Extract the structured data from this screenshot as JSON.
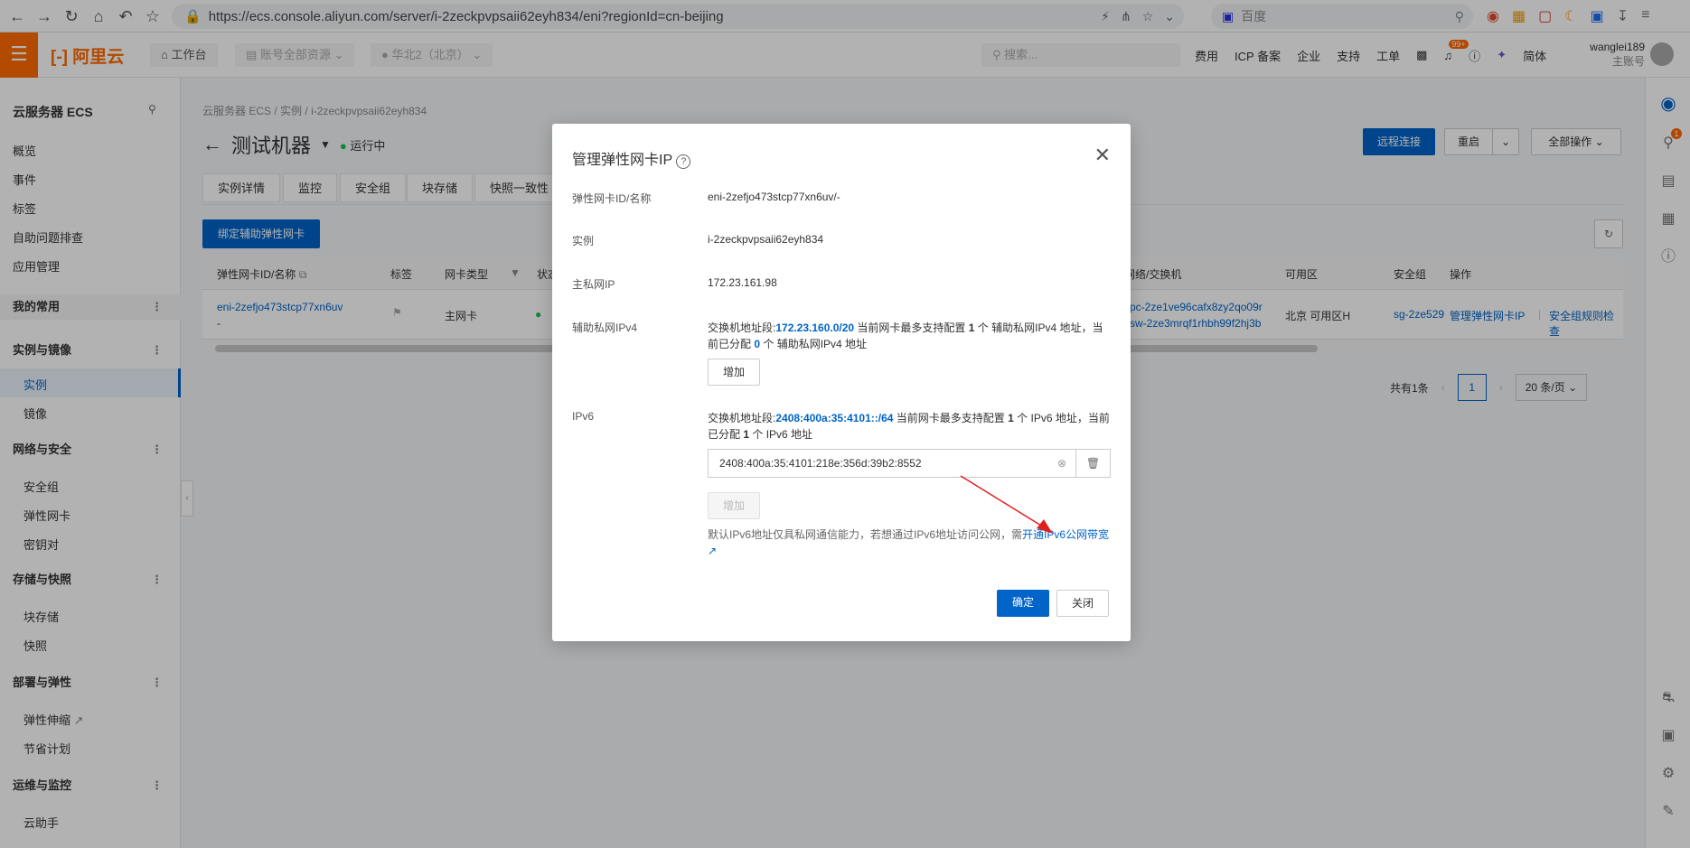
{
  "browser": {
    "url": "https://ecs.console.aliyun.com/server/i-2zeckpvpsaii62eyh834/eni?regionId=cn-beijing",
    "search_placeholder": "百度"
  },
  "topbar": {
    "logo": "阿里云",
    "workbench": "工作台",
    "resources": "账号全部资源",
    "region": "华北2（北京）",
    "search_placeholder": "搜索...",
    "links": [
      "费用",
      "ICP 备案",
      "企业",
      "支持",
      "工单"
    ],
    "badge": "99+",
    "lang": "简体",
    "user": "wanglei189",
    "user_role": "主账号"
  },
  "sidebar": {
    "title": "云服务器 ECS",
    "top_items": [
      "概览",
      "事件",
      "标签",
      "自助问题排查",
      "应用管理"
    ],
    "groups": [
      {
        "label": "我的常用",
        "items": []
      },
      {
        "label": "实例与镜像",
        "items": [
          "实例",
          "镜像"
        ]
      },
      {
        "label": "网络与安全",
        "items": [
          "安全组",
          "弹性网卡",
          "密钥对"
        ]
      },
      {
        "label": "存储与快照",
        "items": [
          "块存储",
          "快照"
        ]
      },
      {
        "label": "部署与弹性",
        "items": [
          "弹性伸缩",
          "节省计划"
        ]
      },
      {
        "label": "运维与监控",
        "items": [
          "云助手"
        ]
      }
    ]
  },
  "main": {
    "breadcrumb": [
      "云服务器 ECS",
      "实例",
      "i-2zeckpvpsaii62eyh834"
    ],
    "instance_name": "测试机器",
    "status": "运行中",
    "remote_btn": "远程连接",
    "restart_btn": "重启",
    "all_ops_btn": "全部操作",
    "tabs": [
      "实例详情",
      "监控",
      "安全组",
      "块存储",
      "快照一致性"
    ],
    "bind_btn": "绑定辅助弹性网卡",
    "table_headers": [
      "弹性网卡ID/名称",
      "标签",
      "网卡类型",
      "状态",
      "网络/交换机",
      "可用区",
      "安全组",
      "操作"
    ],
    "row": {
      "eni_id": "eni-2zefjo473stcp77xn6uv",
      "eni_name": "-",
      "type": "主网卡",
      "vpc": "vpc-2ze1ve96cafx8zy2qo09r",
      "vsw": "vsw-2ze3mrqf1rhbh99f2hj3b",
      "zone": "北京 可用区H",
      "sg": "sg-2ze529",
      "op1": "管理弹性网卡IP",
      "op2": "安全组规则检查"
    },
    "pagination": {
      "total": "共有1条",
      "page": "1",
      "size": "20 条/页"
    }
  },
  "modal": {
    "title": "管理弹性网卡IP",
    "eni_label": "弹性网卡ID/名称",
    "eni_value": "eni-2zefjo473stcp77xn6uv/-",
    "instance_label": "实例",
    "instance_value": "i-2zeckpvpsaii62eyh834",
    "primary_ip_label": "主私网IP",
    "primary_ip_value": "172.23.161.98",
    "secondary_label": "辅助私网IPv4",
    "ipv4_prefix": "交换机地址段:",
    "ipv4_cidr": "172.23.160.0/20",
    "ipv4_mid1": " 当前网卡最多支持配置 ",
    "ipv4_max": "1",
    "ipv4_mid2": " 个 辅助私网IPv4 地址，当前已分配 ",
    "ipv4_assigned": "0",
    "ipv4_suffix": " 个 辅助私网IPv4 地址",
    "add_btn": "增加",
    "ipv6_label": "IPv6",
    "ipv6_prefix": "交换机地址段:",
    "ipv6_cidr": "2408:400a:35:4101::/64",
    "ipv6_mid1": " 当前网卡最多支持配置 ",
    "ipv6_max": "1",
    "ipv6_mid2": " 个 IPv6 地址，当前已分配 ",
    "ipv6_assigned": "1",
    "ipv6_suffix": " 个 IPv6 地址",
    "ipv6_value": "2408:400a:35:4101:218e:356d:39b2:8552",
    "ipv6_add_btn": "增加",
    "note": "默认IPv6地址仅具私网通信能力，若想通过IPv6地址访问公网，需",
    "note_link": "开通IPv6公网带宽",
    "ok_btn": "确定",
    "close_btn": "关闭"
  }
}
